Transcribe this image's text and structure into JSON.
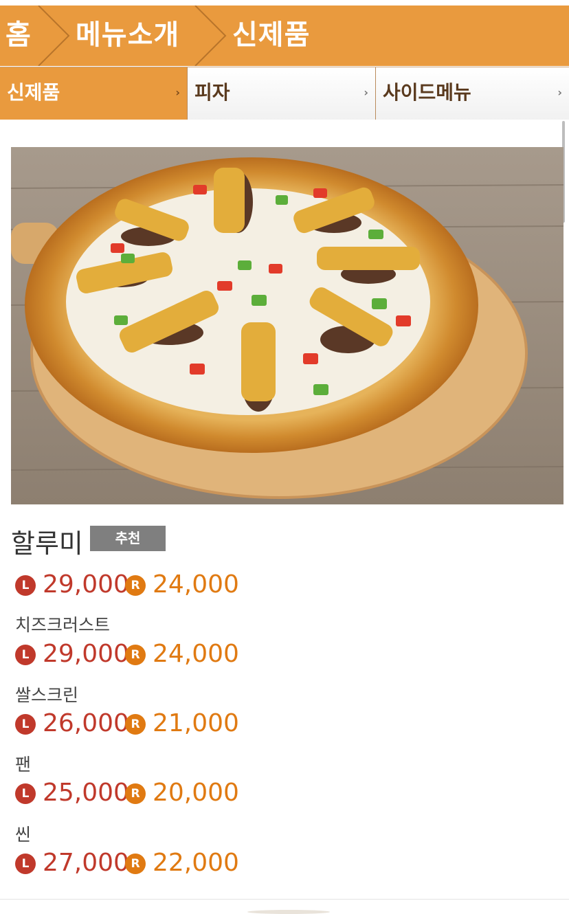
{
  "breadcrumb": {
    "items": [
      "홈",
      "메뉴소개",
      "신제품"
    ]
  },
  "tabs": [
    {
      "label": "신제품",
      "active": true
    },
    {
      "label": "피자",
      "active": false
    },
    {
      "label": "사이드메뉴",
      "active": false
    }
  ],
  "tab_arrow": "›",
  "colors": {
    "accent": "#e99a3e",
    "price_large": "#c0392b",
    "price_regular": "#e07a12",
    "badge": "#7f7f7f"
  },
  "product": {
    "name": "할루미",
    "badge": "추천",
    "main_price": {
      "large": "29,000",
      "regular": "24,000"
    },
    "options": [
      {
        "label": "치즈크러스트",
        "large": "29,000",
        "regular": "24,000"
      },
      {
        "label": "쌀스크린",
        "large": "26,000",
        "regular": "21,000"
      },
      {
        "label": "팬",
        "large": "25,000",
        "regular": "20,000"
      },
      {
        "label": "씬",
        "large": "27,000",
        "regular": "22,000"
      }
    ],
    "size_marks": {
      "large": "L",
      "regular": "R"
    }
  }
}
